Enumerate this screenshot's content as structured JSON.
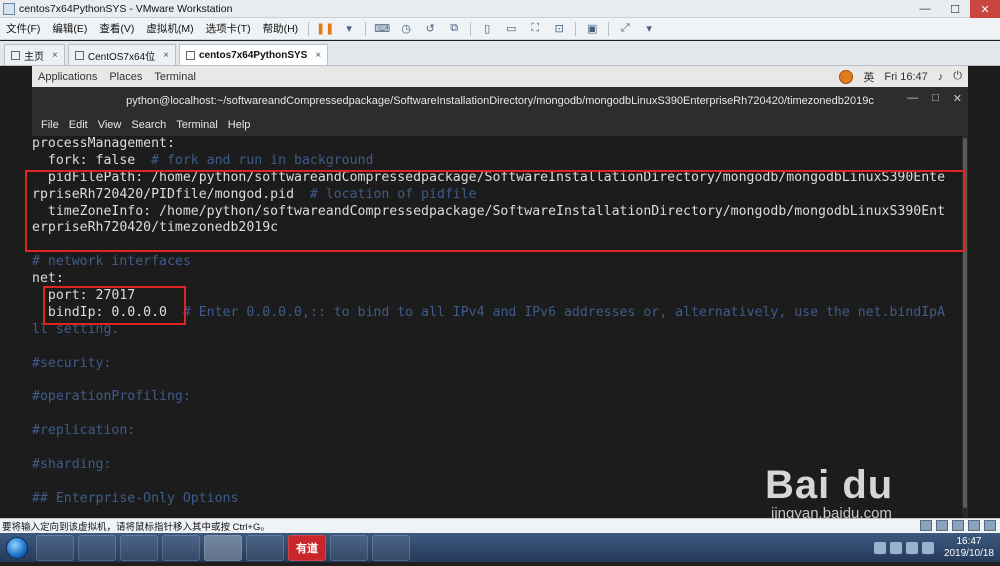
{
  "window": {
    "title": "centos7x64PythonSYS - VMware Workstation",
    "controls": [
      "—",
      "☐",
      "✕"
    ]
  },
  "vm_menu": {
    "items": [
      "文件(F)",
      "编辑(E)",
      "查看(V)",
      "虚拟机(M)",
      "选项卡(T)",
      "帮助(H)"
    ]
  },
  "vm_tabs": [
    {
      "label": "主页",
      "active": false
    },
    {
      "label": "CentOS7x64位",
      "active": false
    },
    {
      "label": "centos7x64PythonSYS",
      "active": true
    }
  ],
  "gnome": {
    "applications": "Applications",
    "places": "Places",
    "terminal": "Terminal",
    "ime": "英",
    "clock": "Fri 16:47",
    "volume_icon": "♪",
    "power_icon": "⏻"
  },
  "terminal": {
    "title": "python@localhost:~/softwareandCompressedpackage/SoftwareInstallationDirectory/mongodb/mongodbLinuxS390EnterpriseRh720420/timezonedb2019c",
    "controls": [
      "—",
      "□",
      "✕"
    ],
    "menu": [
      "File",
      "Edit",
      "View",
      "Search",
      "Terminal",
      "Help"
    ],
    "lines": [
      {
        "text": "processManagement:",
        "comment": ""
      },
      {
        "text": "  fork: false  ",
        "comment": "# fork and run in background"
      },
      {
        "text": "  pidFilePath: /home/python/softwareandCompressedpackage/SoftwareInstallationDirectory/mongodb/mongodbLinuxS390Ente",
        "comment": ""
      },
      {
        "text": "rpriseRh720420/PIDfile/mongod.pid  ",
        "comment": "# location of pidfile"
      },
      {
        "text": "  timeZoneInfo: /home/python/softwareandCompressedpackage/SoftwareInstallationDirectory/mongodb/mongodbLinuxS390Ent",
        "comment": ""
      },
      {
        "text": "erpriseRh720420/timezonedb2019c",
        "comment": ""
      },
      {
        "text": "",
        "comment": ""
      },
      {
        "text": "",
        "comment": "# network interfaces"
      },
      {
        "text": "net:",
        "comment": ""
      },
      {
        "text": "  port: 27017",
        "comment": ""
      },
      {
        "text": "  bindIp: 0.0.0.0  ",
        "comment": "# Enter 0.0.0.0,:: to bind to all IPv4 and IPv6 addresses or, alternatively, use the net.bindIpA"
      },
      {
        "text": "",
        "comment": "ll setting."
      },
      {
        "text": "",
        "comment": ""
      },
      {
        "text": "",
        "comment": "#security:"
      },
      {
        "text": "",
        "comment": ""
      },
      {
        "text": "",
        "comment": "#operationProfiling:"
      },
      {
        "text": "",
        "comment": ""
      },
      {
        "text": "",
        "comment": "#replication:"
      },
      {
        "text": "",
        "comment": ""
      },
      {
        "text": "",
        "comment": "#sharding:"
      },
      {
        "text": "",
        "comment": ""
      },
      {
        "text": "",
        "comment": "## Enterprise-Only Options"
      }
    ]
  },
  "watermark": {
    "main": "Bai du 经验",
    "sub": "jingyan.baidu.com"
  },
  "status_bar": {
    "text": "要将输入定向到该虚拟机，请将鼠标指针移入其中或按 Ctrl+G。"
  },
  "taskbar": {
    "buttons": [
      "",
      "",
      "",
      "",
      "",
      "",
      "有道",
      "",
      ""
    ],
    "clock_time": "16:47",
    "clock_date": "2019/10/18"
  }
}
